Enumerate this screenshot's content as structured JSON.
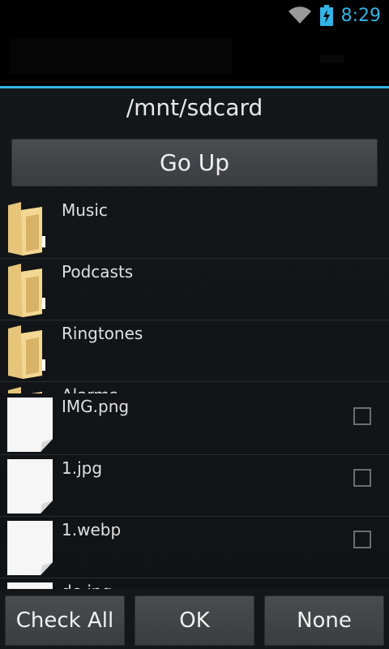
{
  "status_bar": {
    "time": "8:29",
    "wifi_icon": "wifi-icon",
    "battery_icon": "battery-charging-icon",
    "accent_color": "#33b5e5"
  },
  "header": {
    "path": "/mnt/sdcard"
  },
  "go_up": {
    "label": "Go Up"
  },
  "folders": [
    {
      "name": "Music",
      "icon": "folder-icon"
    },
    {
      "name": "Podcasts",
      "icon": "folder-icon"
    },
    {
      "name": "Ringtones",
      "icon": "folder-icon"
    },
    {
      "name": "Alarms",
      "icon": "folder-icon"
    }
  ],
  "files": [
    {
      "name": "IMG.png",
      "icon": "file-icon",
      "checked": false
    },
    {
      "name": "1.jpg",
      "icon": "file-icon",
      "checked": false
    },
    {
      "name": "1.webp",
      "icon": "file-icon",
      "checked": false
    },
    {
      "name": "de.jpg",
      "icon": "file-icon",
      "checked": false
    }
  ],
  "buttons": {
    "check_all": "Check All",
    "ok": "OK",
    "none": "None"
  }
}
